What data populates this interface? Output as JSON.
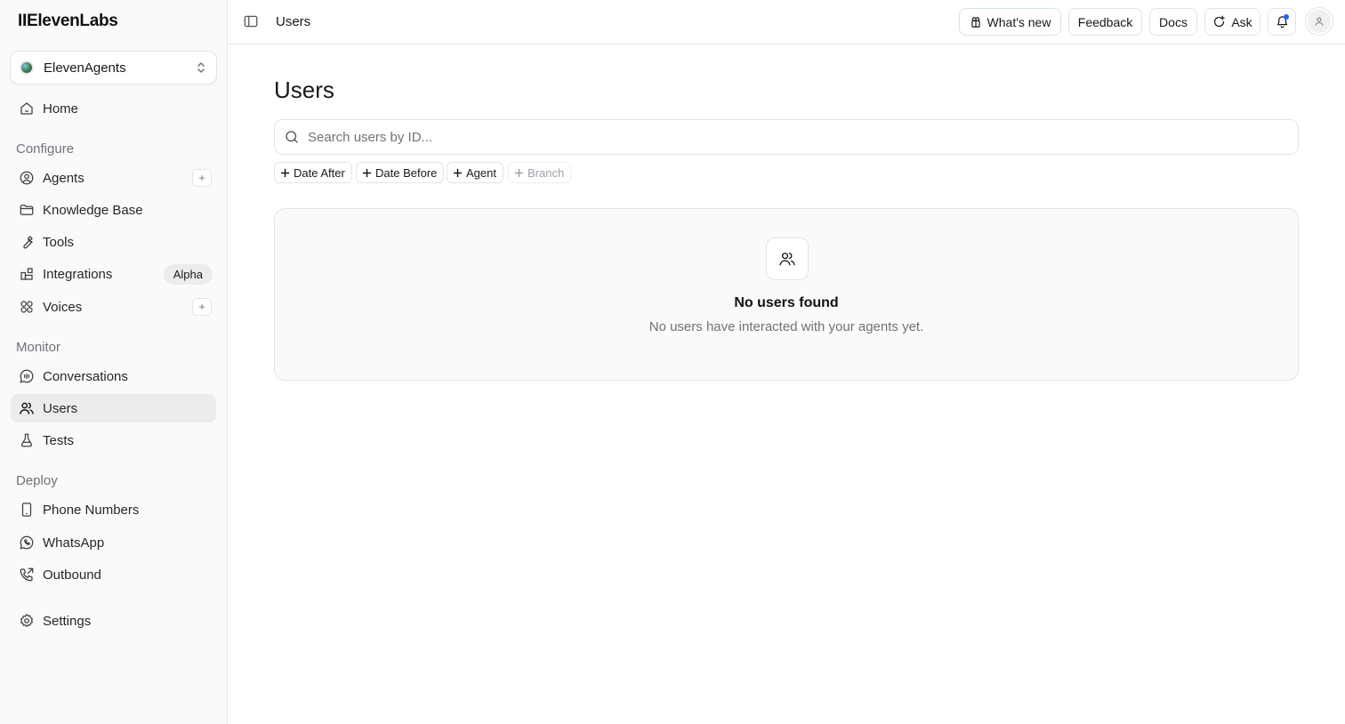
{
  "app": {
    "logo": "IIElevenLabs"
  },
  "workspace": {
    "name": "ElevenAgents"
  },
  "sidebar": {
    "home": "Home",
    "configure_label": "Configure",
    "agents": "Agents",
    "knowledge_base": "Knowledge Base",
    "tools": "Tools",
    "integrations": "Integrations",
    "integrations_badge": "Alpha",
    "voices": "Voices",
    "monitor_label": "Monitor",
    "conversations": "Conversations",
    "users": "Users",
    "tests": "Tests",
    "deploy_label": "Deploy",
    "phone_numbers": "Phone Numbers",
    "whatsapp": "WhatsApp",
    "outbound": "Outbound",
    "settings": "Settings",
    "plus": "+"
  },
  "header": {
    "breadcrumb": "Users",
    "whats_new": "What's new",
    "feedback": "Feedback",
    "docs": "Docs",
    "ask": "Ask"
  },
  "main": {
    "title": "Users",
    "search_placeholder": "Search users by ID...",
    "filters": {
      "date_after": "Date After",
      "date_before": "Date Before",
      "agent": "Agent",
      "branch": "Branch"
    },
    "empty": {
      "title": "No users found",
      "subtitle": "No users have interacted with your agents yet."
    }
  },
  "colors": {
    "accent_notification": "#2563eb",
    "active_nav_bg": "#ececee",
    "sidebar_bg": "#fafafa"
  }
}
